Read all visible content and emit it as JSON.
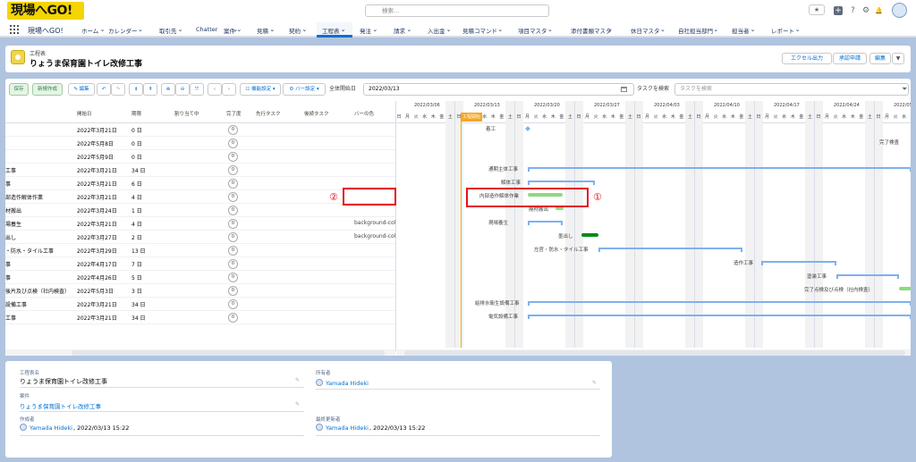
{
  "topbar": {
    "logo_text": "現場へGO!",
    "search_placeholder": "検索...",
    "star_icon": "★",
    "plus_icon": "+",
    "help_icon": "?",
    "gear_icon": "⚙",
    "bell_icon": "🔔"
  },
  "nav": {
    "app_name": "現場へGO!",
    "items": [
      "ホーム",
      "カレンダー",
      "取引先",
      "Chatter",
      "案件",
      "見積",
      "契約",
      "工程表",
      "発注",
      "請求",
      "入出金",
      "見積コマンド",
      "項目マスタ",
      "添付書類マスタ",
      "休日マスタ",
      "自社担当部門",
      "担当者",
      "レポート"
    ]
  },
  "header": {
    "subtitle": "工程表",
    "title": "りょうま保育園トイレ改修工事",
    "buttons": [
      "エクセル出力",
      "承認申請",
      "編集"
    ]
  },
  "toolbar": {
    "save": "保存",
    "new": "新規作成",
    "edit": "✎ 編集",
    "undo_badge": "3",
    "display_settings": "☷ 機能設定 ▾",
    "bar_settings": "⚙ バー設定 ▾",
    "overall_start_label": "全体開始日",
    "overall_start_value": "2022/03/13",
    "task_search_label": "タスクを検索",
    "task_search_placeholder": "タスクを検索"
  },
  "columns": [
    "開始日",
    "期限",
    "割り当て中",
    "完了度",
    "先行タスク",
    "後続タスク",
    "バーの色"
  ],
  "rows": [
    {
      "name": "",
      "start": "2022年3月21日",
      "dur": "0 日",
      "pct": "0",
      "color": ""
    },
    {
      "name": "",
      "start": "2022年5月8日",
      "dur": "0 日",
      "pct": "0",
      "color": ""
    },
    {
      "name": "",
      "start": "2022年5月9日",
      "dur": "0 日",
      "pct": "0",
      "color": ""
    },
    {
      "name": "工事",
      "start": "2022年3月21日",
      "dur": "34 日",
      "pct": "0",
      "color": ""
    },
    {
      "name": "事",
      "start": "2022年3月21日",
      "dur": "6 日",
      "pct": "0",
      "color": ""
    },
    {
      "name": "部造作解体作業",
      "start": "2022年3月21日",
      "dur": "4 日",
      "pct": "0",
      "color": ""
    },
    {
      "name": "材搬出",
      "start": "2022年3月24日",
      "dur": "1 日",
      "pct": "0",
      "color": ""
    },
    {
      "name": "場養生",
      "start": "2022年3月21日",
      "dur": "4 日",
      "pct": "0",
      "color": "background-col"
    },
    {
      "name": "出し",
      "start": "2022年3月27日",
      "dur": "2 日",
      "pct": "0",
      "color": "background-col"
    },
    {
      "name": "・防水・タイル工事",
      "start": "2022年3月29日",
      "dur": "13 日",
      "pct": "0",
      "color": ""
    },
    {
      "name": "事",
      "start": "2022年4月17日",
      "dur": "7 日",
      "pct": "0",
      "color": ""
    },
    {
      "name": "事",
      "start": "2022年4月26日",
      "dur": "5 日",
      "pct": "0",
      "color": ""
    },
    {
      "name": "後片及び点検（社内検査）",
      "start": "2022年5月3日",
      "dur": "3 日",
      "pct": "0",
      "color": ""
    },
    {
      "name": "設備工事",
      "start": "2022年3月21日",
      "dur": "34 日",
      "pct": "0",
      "color": ""
    },
    {
      "name": "工事",
      "start": "2022年3月21日",
      "dur": "34 日",
      "pct": "0",
      "color": ""
    }
  ],
  "gantt": {
    "weeks": [
      "2022/03/06",
      "2022/03/13",
      "2022/03/20",
      "2022/03/27",
      "2022/04/03",
      "2022/04/10",
      "2022/04/17",
      "2022/04/24",
      "2022/05/0"
    ],
    "days": [
      "日",
      "月",
      "火",
      "水",
      "木",
      "金",
      "土"
    ],
    "today_label": "工程開始",
    "task_labels": [
      "着工",
      "完了検査",
      "通期主体工事",
      "解体工事",
      "内部造作解体作業",
      "廃材搬出",
      "現場養生",
      "墨出し",
      "左官・防水・タイル工事",
      "造作工事",
      "塗装工事",
      "完了点検及び点検（社内検査）",
      "給排水衛生設備工事",
      "電気設備工事"
    ]
  },
  "annotations": {
    "one": "①",
    "two": "②"
  },
  "details": {
    "name_label": "工程表名",
    "name_value": "りょうま保育園トイレ改修工事",
    "project_label": "案件",
    "project_value": "りょうま保育園トイレ改修工事",
    "owner_label": "所有者",
    "owner_value": "Yamada Hideki",
    "created_label": "作成者",
    "created_user": "Yamada Hideki",
    "created_date": ", 2022/03/13 15:22",
    "modified_label": "最終更新者",
    "modified_user": "Yamada Hideki",
    "modified_date": ", 2022/03/13 15:22"
  },
  "colors": {
    "accent": "#0070d2",
    "bar_blue": "#7fb0f0",
    "bar_green_light": "#8ed97f",
    "bar_green_dark": "#0a8a1a",
    "annotation_red": "#e5101d",
    "today": "#f5a623"
  }
}
